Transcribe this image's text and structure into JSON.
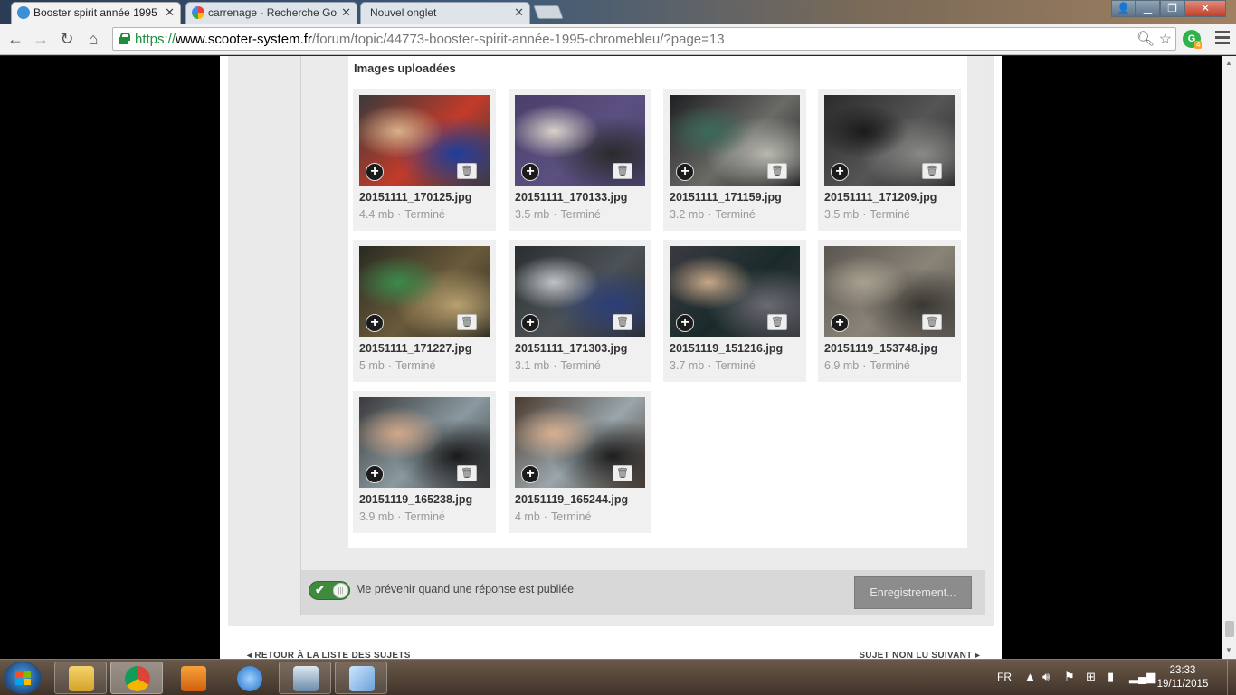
{
  "browser": {
    "tabs": [
      {
        "label": "Booster spirit année 1995",
        "active": true
      },
      {
        "label": "carrenage - Recherche Go",
        "active": false
      },
      {
        "label": "Nouvel onglet",
        "active": false
      }
    ],
    "url": {
      "scheme": "https://",
      "host": "www.scooter-system.fr",
      "path": "/forum/topic/44773-booster-spirit-année-1995-chromebleu/?page=13"
    },
    "extension_badge": "4",
    "window_controls": {
      "minimize": "▁",
      "maximize": "❐",
      "close": "✕",
      "user": "👤"
    }
  },
  "page": {
    "section_title": "Images uploadées",
    "images": [
      {
        "name": "20151111_170125.jpg",
        "size": "4.4 mb",
        "status": "Terminé",
        "colors": [
          "#3a3a3a",
          "#c23b2a",
          "#1d3e9a",
          "#d7b08a"
        ]
      },
      {
        "name": "20151111_170133.jpg",
        "size": "3.5 mb",
        "status": "Terminé",
        "colors": [
          "#4a3f6a",
          "#5b5080",
          "#2a2a2a",
          "#d8d2c8"
        ]
      },
      {
        "name": "20151111_171159.jpg",
        "size": "3.2 mb",
        "status": "Terminé",
        "colors": [
          "#1e2022",
          "#6a6a66",
          "#b8b8b0",
          "#3a6a5a"
        ]
      },
      {
        "name": "20151111_171209.jpg",
        "size": "3.5 mb",
        "status": "Terminé",
        "colors": [
          "#2b2b2b",
          "#555555",
          "#8a8a88",
          "#1a1a1a"
        ]
      },
      {
        "name": "20151111_171227.jpg",
        "size": "5 mb",
        "status": "Terminé",
        "colors": [
          "#2a2a22",
          "#6a5a3a",
          "#b8a070",
          "#3a8a4a"
        ]
      },
      {
        "name": "20151111_171303.jpg",
        "size": "3.1 mb",
        "status": "Terminé",
        "colors": [
          "#2a2e30",
          "#4c5256",
          "#2c3e7a",
          "#c0c4c6"
        ]
      },
      {
        "name": "20151119_151216.jpg",
        "size": "3.7 mb",
        "status": "Terminé",
        "colors": [
          "#3a3a40",
          "#1a2a2a",
          "#6a6a72",
          "#c8a888"
        ]
      },
      {
        "name": "20151119_153748.jpg",
        "size": "6.9 mb",
        "status": "Terminé",
        "colors": [
          "#5a5650",
          "#8a8478",
          "#3a3834",
          "#a8a090"
        ]
      },
      {
        "name": "20151119_165238.jpg",
        "size": "3.9 mb",
        "status": "Terminé",
        "colors": [
          "#3a3a3c",
          "#8a9aa0",
          "#1a1a1a",
          "#d2a888"
        ]
      },
      {
        "name": "20151119_165244.jpg",
        "size": "4 mb",
        "status": "Terminé",
        "colors": [
          "#4a3a2e",
          "#9aa6ac",
          "#1e1e1e",
          "#d8b090"
        ]
      }
    ],
    "separator": "·",
    "notify_label": "Me prévenir quand une réponse est publiée",
    "notify_enabled": true,
    "save_button": "Enregistrement...",
    "nav_prev": "◂  RETOUR À LA LISTE DES SUJETS",
    "nav_next": "SUJET NON LU SUIVANT  ▸"
  },
  "taskbar": {
    "language": "FR",
    "time": "23:33",
    "date": "19/11/2015"
  }
}
